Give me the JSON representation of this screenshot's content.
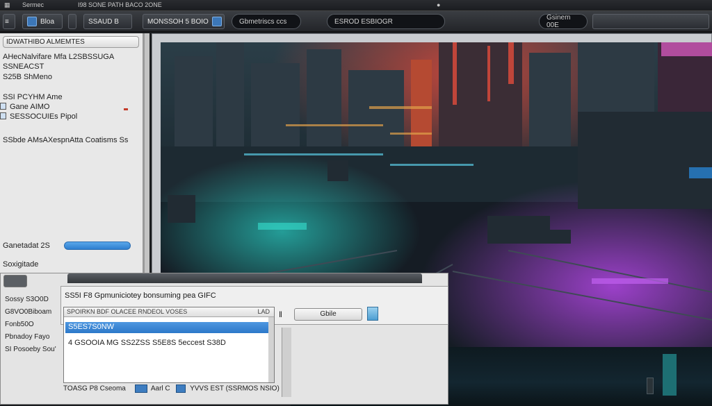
{
  "window": {
    "title_left": "Sermec",
    "title_center": "I98 SONE PATH BACO 2ONE"
  },
  "toolbar": {
    "btn1_label": "Bloa",
    "btn2_label": "SSAUD B",
    "btn3_label": "MONSSOH 5 BOIO",
    "field1_label": "Gbmetriscs ccs",
    "field2_label": "ESROD ESBIOGR",
    "field3_label": "Gsinem 00E"
  },
  "left_panel": {
    "header": "IDWATHIBO ALMEMTES",
    "lines": [
      "AHecNalvifare Mfa L2SBSSUGA",
      "SSNEACST",
      "S25B ShMeno",
      "SSI PCYHM Ame",
      "Gane AIMO",
      "SESSOCUIEs Pipol",
      "SSbde  AMsAXespnAtta Coatisms Ss",
      "Ganetadat 2S",
      "Soxigitade"
    ],
    "progress_value": 1.0
  },
  "dialog": {
    "title": "SS5I F8 Gpmuniciotey bonsuming pea GIFC",
    "side_labels": [
      "Sossy S3O0D",
      "G8VO0Biboam",
      "Fonb50O",
      "Pbnadoy Fayo",
      "SI Posoeby Sou'"
    ],
    "list_header_left": "SPOIRKN BDF OLACEE RNDEOL VOSES",
    "list_header_right": "LAD",
    "selected_row": "S5ES7S0NW",
    "row2": "4 GSOOIA  MG SS2ZSS  S5E8S 5eccest  S38D",
    "button_label": "Gbile",
    "footer_text": "TOASG P8 Cseoma",
    "footer_text2": "Aarl C",
    "footer_text3": "YVVS EST (SSRMOS NSIO)"
  },
  "colors": {
    "accent_blue": "#2f7fcf",
    "selection": "#3a86d6",
    "neon_purple": "#b347e6",
    "neon_teal": "#2ad3c8"
  }
}
